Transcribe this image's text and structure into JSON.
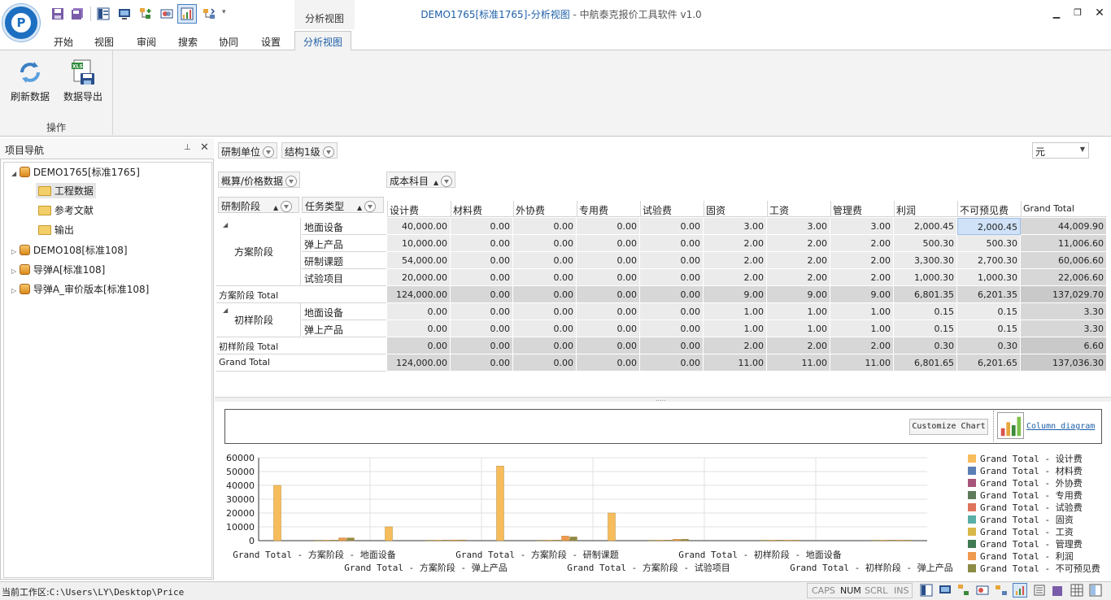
{
  "app": {
    "title_doc": "DEMO1765[标准1765]-分析视图",
    "title_app": " - 中航泰克报价工具软件 v1.0",
    "context_tab": "分析视图",
    "logo_letter": "P"
  },
  "quick_access": [
    "save-icon",
    "save-all-icon",
    "panel-icon",
    "monitor-icon",
    "tree-add-icon",
    "compare-icon",
    "analysis-icon",
    "export-tree-icon"
  ],
  "ribbon": {
    "tabs": [
      "开始",
      "视图",
      "审阅",
      "搜索",
      "协同",
      "设置",
      "分析视图"
    ],
    "active_tab": "分析视图",
    "buttons": {
      "refresh": "刷新数据",
      "export": "数据导出"
    },
    "group_label": "操作"
  },
  "nav": {
    "title": "项目导航",
    "pin": "📌",
    "close": "✕",
    "tree": [
      {
        "label": "DEMO1765[标准1765]",
        "expanded": true,
        "children": [
          "工程数据",
          "参考文献",
          "输出"
        ]
      },
      {
        "label": "DEMO108[标准108]"
      },
      {
        "label": "导弹A[标准108]"
      },
      {
        "label": "导弹A_审价版本[标准108]"
      }
    ]
  },
  "pivot": {
    "filter_fields": [
      "研制单位",
      "结构1级"
    ],
    "data_field": "概算/价格数据",
    "column_field": "成本科目",
    "row_fields": [
      "研制阶段",
      "任务类型"
    ],
    "unit": "元",
    "columns": [
      "设计费",
      "材料费",
      "外协费",
      "专用费",
      "试验费",
      "固资",
      "工资",
      "管理费",
      "利润",
      "不可预见费",
      "Grand Total"
    ],
    "groups": [
      {
        "name": "方案阶段",
        "rows": [
          {
            "type": "地面设备",
            "values": [
              "40,000.00",
              "0.00",
              "0.00",
              "0.00",
              "0.00",
              "3.00",
              "3.00",
              "3.00",
              "2,000.45",
              "2,000.45",
              "44,009.90"
            ]
          },
          {
            "type": "弹上产品",
            "values": [
              "10,000.00",
              "0.00",
              "0.00",
              "0.00",
              "0.00",
              "2.00",
              "2.00",
              "2.00",
              "500.30",
              "500.30",
              "11,006.60"
            ]
          },
          {
            "type": "研制课题",
            "values": [
              "54,000.00",
              "0.00",
              "0.00",
              "0.00",
              "0.00",
              "2.00",
              "2.00",
              "2.00",
              "3,300.30",
              "2,700.30",
              "60,006.60"
            ]
          },
          {
            "type": "试验项目",
            "values": [
              "20,000.00",
              "0.00",
              "0.00",
              "0.00",
              "0.00",
              "2.00",
              "2.00",
              "2.00",
              "1,000.30",
              "1,000.30",
              "22,006.60"
            ]
          }
        ],
        "total_label": "方案阶段 Total",
        "total": [
          "124,000.00",
          "0.00",
          "0.00",
          "0.00",
          "0.00",
          "9.00",
          "9.00",
          "9.00",
          "6,801.35",
          "6,201.35",
          "137,029.70"
        ]
      },
      {
        "name": "初样阶段",
        "rows": [
          {
            "type": "地面设备",
            "values": [
              "0.00",
              "0.00",
              "0.00",
              "0.00",
              "0.00",
              "1.00",
              "1.00",
              "1.00",
              "0.15",
              "0.15",
              "3.30"
            ]
          },
          {
            "type": "弹上产品",
            "values": [
              "0.00",
              "0.00",
              "0.00",
              "0.00",
              "0.00",
              "1.00",
              "1.00",
              "1.00",
              "0.15",
              "0.15",
              "3.30"
            ]
          }
        ],
        "total_label": "初样阶段 Total",
        "total": [
          "0.00",
          "0.00",
          "0.00",
          "0.00",
          "0.00",
          "2.00",
          "2.00",
          "2.00",
          "0.30",
          "0.30",
          "6.60"
        ]
      }
    ],
    "grand_total_label": "Grand Total",
    "grand_total": [
      "124,000.00",
      "0.00",
      "0.00",
      "0.00",
      "0.00",
      "11.00",
      "11.00",
      "11.00",
      "6,801.65",
      "6,201.65",
      "137,036.30"
    ]
  },
  "chart_toolbar": {
    "customize": "Customize Chart",
    "diagram_link": "Column diagram"
  },
  "chart_data": {
    "type": "bar",
    "categories": [
      "Grand Total - 方案阶段 - 地面设备",
      "Grand Total - 方案阶段 - 弹上产品",
      "Grand Total - 方案阶段 - 研制课题",
      "Grand Total - 方案阶段 - 试验项目",
      "Grand Total - 初样阶段 - 地面设备",
      "Grand Total - 初样阶段 - 弹上产品"
    ],
    "ylim": [
      0,
      60000
    ],
    "yticks": [
      "60000",
      "50000",
      "40000",
      "30000",
      "20000",
      "10000",
      "0"
    ],
    "grid": true,
    "legend_position": "right",
    "series": [
      {
        "name": "Grand Total - 设计费",
        "color": "#f7bd5c",
        "values": [
          40000,
          10000,
          54000,
          20000,
          0,
          0
        ]
      },
      {
        "name": "Grand Total - 材料费",
        "color": "#5b7fb5",
        "values": [
          0,
          0,
          0,
          0,
          0,
          0
        ]
      },
      {
        "name": "Grand Total - 外协费",
        "color": "#a8557a",
        "values": [
          0,
          0,
          0,
          0,
          0,
          0
        ]
      },
      {
        "name": "Grand Total - 专用费",
        "color": "#5e7a5a",
        "values": [
          0,
          0,
          0,
          0,
          0,
          0
        ]
      },
      {
        "name": "Grand Total - 试验费",
        "color": "#e0735b",
        "values": [
          0,
          0,
          0,
          0,
          0,
          0
        ]
      },
      {
        "name": "Grand Total - 固资",
        "color": "#5aaea5",
        "values": [
          3,
          2,
          2,
          2,
          1,
          1
        ]
      },
      {
        "name": "Grand Total - 工资",
        "color": "#d9b84a",
        "values": [
          3,
          2,
          2,
          2,
          1,
          1
        ]
      },
      {
        "name": "Grand Total - 管理费",
        "color": "#3f7a52",
        "values": [
          3,
          2,
          2,
          2,
          1,
          1
        ]
      },
      {
        "name": "Grand Total - 利润",
        "color": "#ef9a4e",
        "values": [
          2000.45,
          500.3,
          3300.3,
          1000.3,
          0.15,
          0.15
        ]
      },
      {
        "name": "Grand Total - 不可预见费",
        "color": "#8c8c47",
        "values": [
          2000.45,
          500.3,
          2700.3,
          1000.3,
          0.15,
          0.15
        ]
      }
    ]
  },
  "status": {
    "path_label": "当前工作区:",
    "path": "C:\\Users\\LY\\Desktop\\Price",
    "keys": [
      "CAPS",
      "NUM",
      "SCRL",
      "INS"
    ],
    "active_key": "NUM"
  }
}
